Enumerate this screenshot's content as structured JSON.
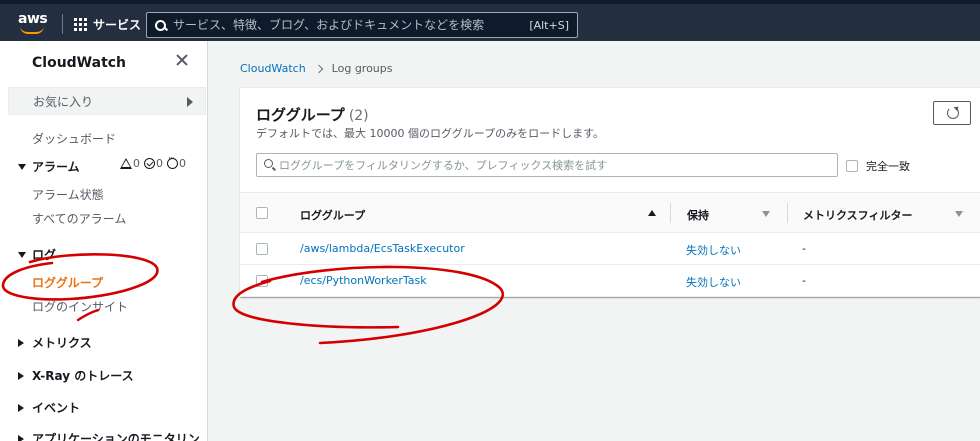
{
  "topnav": {
    "logo_text": "aws",
    "services_label": "サービス",
    "search_placeholder": "サービス、特徴、ブログ、およびドキュメントなどを検索",
    "search_shortcut": "[Alt+S]"
  },
  "sidebar": {
    "title": "CloudWatch",
    "favorites_label": "お気に入り",
    "dashboard_label": "ダッシュボード",
    "alarms": {
      "label": "アラーム",
      "warn_count": "0",
      "ok_count": "0",
      "insufficient_count": "0",
      "items": [
        "アラーム状態",
        "すべてのアラーム"
      ]
    },
    "logs": {
      "label": "ログ",
      "items": [
        "ロググループ",
        "ログのインサイト"
      ],
      "active_item": "ロググループ"
    },
    "collapsed_sections": [
      "メトリクス",
      "X-Ray のトレース",
      "イベント",
      "アプリケーションのモニタリン"
    ]
  },
  "breadcrumb": [
    "CloudWatch",
    "Log groups"
  ],
  "main": {
    "title": "ロググループ",
    "count": "(2)",
    "description": "デフォルトでは、最大 10000 個のロググループのみをロードします。",
    "filter_placeholder": "ロググループをフィルタリングするか、プレフィックス検索を試す",
    "exact_match_label": "完全一致",
    "columns": [
      "ロググループ",
      "保持",
      "メトリクスフィルター"
    ],
    "rows": [
      {
        "name": "/aws/lambda/EcsTaskExecutor",
        "retention": "失効しない",
        "metric_filters": "-"
      },
      {
        "name": "/ecs/PythonWorkerTask",
        "retention": "失効しない",
        "metric_filters": "-"
      }
    ]
  },
  "colors": {
    "nav_bg": "#232f3e",
    "link": "#0073bb",
    "active": "#ec7211",
    "annotation": "#d40000"
  }
}
